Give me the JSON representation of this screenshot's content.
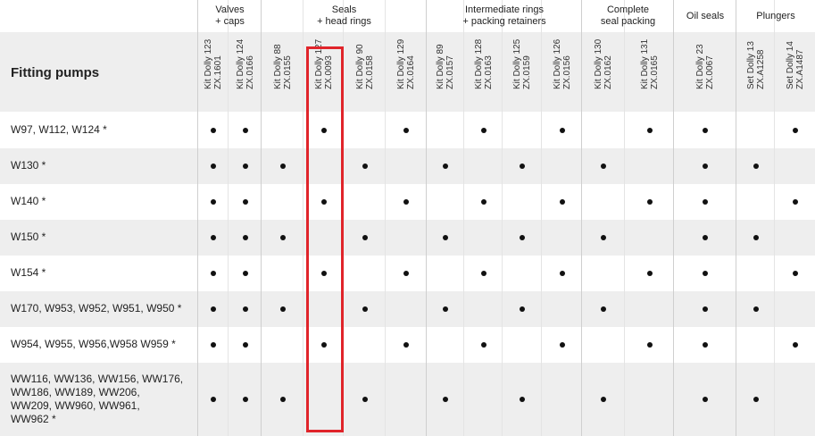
{
  "table": {
    "title": "Fitting pumps",
    "groups": [
      {
        "label": "Valves\n+ caps",
        "span": 2
      },
      {
        "label": "Seals\n+ head rings",
        "span": 4
      },
      {
        "label": "Intermediate rings\n+ packing retainers",
        "span": 4
      },
      {
        "label": "Complete\nseal packing",
        "span": 2
      },
      {
        "label": "Oil seals",
        "span": 1
      },
      {
        "label": "Plungers",
        "span": 2
      }
    ],
    "columns": [
      {
        "name": "Kit Dolly 123",
        "code": "ZX.1601"
      },
      {
        "name": "Kit Dolly 124",
        "code": "ZX.0166"
      },
      {
        "name": "Kit Dolly 88",
        "code": "ZX.0155"
      },
      {
        "name": "Kit Dolly 127",
        "code": "ZX.0093"
      },
      {
        "name": "Kit Dolly 90",
        "code": "ZX.0158"
      },
      {
        "name": "Kit Dolly 129",
        "code": "ZX.0164"
      },
      {
        "name": "Kit Dolly 89",
        "code": "ZX.0157"
      },
      {
        "name": "Kit Dolly 128",
        "code": "ZX.0163"
      },
      {
        "name": "Kit Dolly 125",
        "code": "ZX.0159"
      },
      {
        "name": "Kit Dolly 126",
        "code": "ZX.0156"
      },
      {
        "name": "Kit Dolly 130",
        "code": "ZX.0162"
      },
      {
        "name": "Kit Dolly 131",
        "code": "ZX.0165"
      },
      {
        "name": "Kit Dolly 23",
        "code": "ZX.0067"
      },
      {
        "name": "Set Dolly 13",
        "code": "ZX.A1258"
      },
      {
        "name": "Set Dolly 14",
        "code": "ZX.A1487"
      }
    ],
    "rows": [
      {
        "label": "W97, W112, W124 *",
        "marks": [
          1,
          1,
          0,
          1,
          0,
          1,
          0,
          1,
          0,
          1,
          0,
          1,
          1,
          0,
          1
        ]
      },
      {
        "label": "W130 *",
        "marks": [
          1,
          1,
          1,
          0,
          1,
          0,
          1,
          0,
          1,
          0,
          1,
          0,
          1,
          1,
          0
        ]
      },
      {
        "label": "W140 *",
        "marks": [
          1,
          1,
          0,
          1,
          0,
          1,
          0,
          1,
          0,
          1,
          0,
          1,
          1,
          0,
          1
        ]
      },
      {
        "label": "W150 *",
        "marks": [
          1,
          1,
          1,
          0,
          1,
          0,
          1,
          0,
          1,
          0,
          1,
          0,
          1,
          1,
          0
        ]
      },
      {
        "label": "W154 *",
        "marks": [
          1,
          1,
          0,
          1,
          0,
          1,
          0,
          1,
          0,
          1,
          0,
          1,
          1,
          0,
          1
        ]
      },
      {
        "label": "W170, W953, W952, W951, W950 *",
        "marks": [
          1,
          1,
          1,
          0,
          1,
          0,
          1,
          0,
          1,
          0,
          1,
          0,
          1,
          1,
          0
        ]
      },
      {
        "label": "W954, W955, W956,W958 W959 *",
        "marks": [
          1,
          1,
          0,
          1,
          0,
          1,
          0,
          1,
          0,
          1,
          0,
          1,
          1,
          0,
          1
        ]
      },
      {
        "label": "WW116, WW136, WW156, WW176,\nWW186, WW189, WW206,\nWW209, WW960, WW961,\nWW962 *",
        "marks": [
          1,
          1,
          1,
          0,
          1,
          0,
          1,
          0,
          1,
          0,
          1,
          0,
          1,
          1,
          0
        ]
      }
    ],
    "highlighted_column_index": 3,
    "highlight_color": "#e0242a",
    "dot_symbol": "•"
  }
}
